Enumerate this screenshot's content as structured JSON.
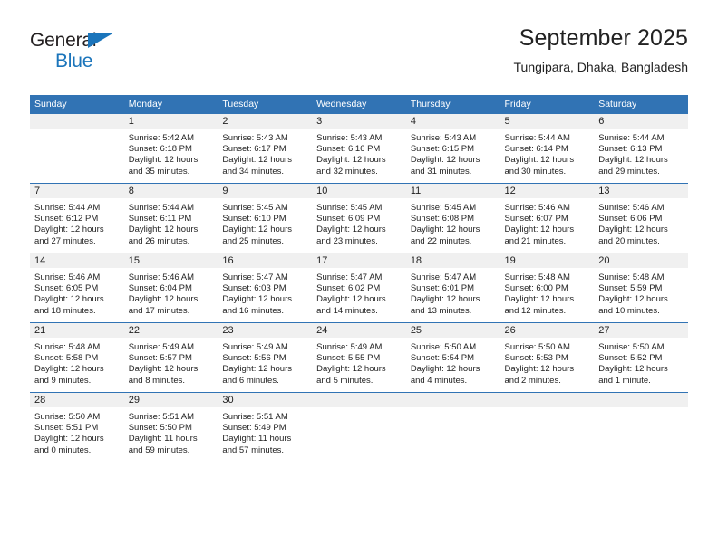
{
  "brand": {
    "line1": "General",
    "line2": "Blue",
    "triangle_color": "#1b75bb",
    "text_color": "#231f20"
  },
  "header": {
    "title": "September 2025",
    "subtitle": "Tungipara, Dhaka, Bangladesh"
  },
  "theme": {
    "accent": "#3173b4",
    "band": "#f0f0f0",
    "text": "#222222"
  },
  "calendar": {
    "weekday_headers": [
      "Sunday",
      "Monday",
      "Tuesday",
      "Wednesday",
      "Thursday",
      "Friday",
      "Saturday"
    ],
    "weeks": [
      [
        {
          "day": "",
          "sunrise": "",
          "sunset": "",
          "daylight_line1": "",
          "daylight_line2": ""
        },
        {
          "day": "1",
          "sunrise": "Sunrise: 5:42 AM",
          "sunset": "Sunset: 6:18 PM",
          "daylight_line1": "Daylight: 12 hours",
          "daylight_line2": "and 35 minutes."
        },
        {
          "day": "2",
          "sunrise": "Sunrise: 5:43 AM",
          "sunset": "Sunset: 6:17 PM",
          "daylight_line1": "Daylight: 12 hours",
          "daylight_line2": "and 34 minutes."
        },
        {
          "day": "3",
          "sunrise": "Sunrise: 5:43 AM",
          "sunset": "Sunset: 6:16 PM",
          "daylight_line1": "Daylight: 12 hours",
          "daylight_line2": "and 32 minutes."
        },
        {
          "day": "4",
          "sunrise": "Sunrise: 5:43 AM",
          "sunset": "Sunset: 6:15 PM",
          "daylight_line1": "Daylight: 12 hours",
          "daylight_line2": "and 31 minutes."
        },
        {
          "day": "5",
          "sunrise": "Sunrise: 5:44 AM",
          "sunset": "Sunset: 6:14 PM",
          "daylight_line1": "Daylight: 12 hours",
          "daylight_line2": "and 30 minutes."
        },
        {
          "day": "6",
          "sunrise": "Sunrise: 5:44 AM",
          "sunset": "Sunset: 6:13 PM",
          "daylight_line1": "Daylight: 12 hours",
          "daylight_line2": "and 29 minutes."
        }
      ],
      [
        {
          "day": "7",
          "sunrise": "Sunrise: 5:44 AM",
          "sunset": "Sunset: 6:12 PM",
          "daylight_line1": "Daylight: 12 hours",
          "daylight_line2": "and 27 minutes."
        },
        {
          "day": "8",
          "sunrise": "Sunrise: 5:44 AM",
          "sunset": "Sunset: 6:11 PM",
          "daylight_line1": "Daylight: 12 hours",
          "daylight_line2": "and 26 minutes."
        },
        {
          "day": "9",
          "sunrise": "Sunrise: 5:45 AM",
          "sunset": "Sunset: 6:10 PM",
          "daylight_line1": "Daylight: 12 hours",
          "daylight_line2": "and 25 minutes."
        },
        {
          "day": "10",
          "sunrise": "Sunrise: 5:45 AM",
          "sunset": "Sunset: 6:09 PM",
          "daylight_line1": "Daylight: 12 hours",
          "daylight_line2": "and 23 minutes."
        },
        {
          "day": "11",
          "sunrise": "Sunrise: 5:45 AM",
          "sunset": "Sunset: 6:08 PM",
          "daylight_line1": "Daylight: 12 hours",
          "daylight_line2": "and 22 minutes."
        },
        {
          "day": "12",
          "sunrise": "Sunrise: 5:46 AM",
          "sunset": "Sunset: 6:07 PM",
          "daylight_line1": "Daylight: 12 hours",
          "daylight_line2": "and 21 minutes."
        },
        {
          "day": "13",
          "sunrise": "Sunrise: 5:46 AM",
          "sunset": "Sunset: 6:06 PM",
          "daylight_line1": "Daylight: 12 hours",
          "daylight_line2": "and 20 minutes."
        }
      ],
      [
        {
          "day": "14",
          "sunrise": "Sunrise: 5:46 AM",
          "sunset": "Sunset: 6:05 PM",
          "daylight_line1": "Daylight: 12 hours",
          "daylight_line2": "and 18 minutes."
        },
        {
          "day": "15",
          "sunrise": "Sunrise: 5:46 AM",
          "sunset": "Sunset: 6:04 PM",
          "daylight_line1": "Daylight: 12 hours",
          "daylight_line2": "and 17 minutes."
        },
        {
          "day": "16",
          "sunrise": "Sunrise: 5:47 AM",
          "sunset": "Sunset: 6:03 PM",
          "daylight_line1": "Daylight: 12 hours",
          "daylight_line2": "and 16 minutes."
        },
        {
          "day": "17",
          "sunrise": "Sunrise: 5:47 AM",
          "sunset": "Sunset: 6:02 PM",
          "daylight_line1": "Daylight: 12 hours",
          "daylight_line2": "and 14 minutes."
        },
        {
          "day": "18",
          "sunrise": "Sunrise: 5:47 AM",
          "sunset": "Sunset: 6:01 PM",
          "daylight_line1": "Daylight: 12 hours",
          "daylight_line2": "and 13 minutes."
        },
        {
          "day": "19",
          "sunrise": "Sunrise: 5:48 AM",
          "sunset": "Sunset: 6:00 PM",
          "daylight_line1": "Daylight: 12 hours",
          "daylight_line2": "and 12 minutes."
        },
        {
          "day": "20",
          "sunrise": "Sunrise: 5:48 AM",
          "sunset": "Sunset: 5:59 PM",
          "daylight_line1": "Daylight: 12 hours",
          "daylight_line2": "and 10 minutes."
        }
      ],
      [
        {
          "day": "21",
          "sunrise": "Sunrise: 5:48 AM",
          "sunset": "Sunset: 5:58 PM",
          "daylight_line1": "Daylight: 12 hours",
          "daylight_line2": "and 9 minutes."
        },
        {
          "day": "22",
          "sunrise": "Sunrise: 5:49 AM",
          "sunset": "Sunset: 5:57 PM",
          "daylight_line1": "Daylight: 12 hours",
          "daylight_line2": "and 8 minutes."
        },
        {
          "day": "23",
          "sunrise": "Sunrise: 5:49 AM",
          "sunset": "Sunset: 5:56 PM",
          "daylight_line1": "Daylight: 12 hours",
          "daylight_line2": "and 6 minutes."
        },
        {
          "day": "24",
          "sunrise": "Sunrise: 5:49 AM",
          "sunset": "Sunset: 5:55 PM",
          "daylight_line1": "Daylight: 12 hours",
          "daylight_line2": "and 5 minutes."
        },
        {
          "day": "25",
          "sunrise": "Sunrise: 5:50 AM",
          "sunset": "Sunset: 5:54 PM",
          "daylight_line1": "Daylight: 12 hours",
          "daylight_line2": "and 4 minutes."
        },
        {
          "day": "26",
          "sunrise": "Sunrise: 5:50 AM",
          "sunset": "Sunset: 5:53 PM",
          "daylight_line1": "Daylight: 12 hours",
          "daylight_line2": "and 2 minutes."
        },
        {
          "day": "27",
          "sunrise": "Sunrise: 5:50 AM",
          "sunset": "Sunset: 5:52 PM",
          "daylight_line1": "Daylight: 12 hours",
          "daylight_line2": "and 1 minute."
        }
      ],
      [
        {
          "day": "28",
          "sunrise": "Sunrise: 5:50 AM",
          "sunset": "Sunset: 5:51 PM",
          "daylight_line1": "Daylight: 12 hours",
          "daylight_line2": "and 0 minutes."
        },
        {
          "day": "29",
          "sunrise": "Sunrise: 5:51 AM",
          "sunset": "Sunset: 5:50 PM",
          "daylight_line1": "Daylight: 11 hours",
          "daylight_line2": "and 59 minutes."
        },
        {
          "day": "30",
          "sunrise": "Sunrise: 5:51 AM",
          "sunset": "Sunset: 5:49 PM",
          "daylight_line1": "Daylight: 11 hours",
          "daylight_line2": "and 57 minutes."
        },
        {
          "day": "",
          "sunrise": "",
          "sunset": "",
          "daylight_line1": "",
          "daylight_line2": ""
        },
        {
          "day": "",
          "sunrise": "",
          "sunset": "",
          "daylight_line1": "",
          "daylight_line2": ""
        },
        {
          "day": "",
          "sunrise": "",
          "sunset": "",
          "daylight_line1": "",
          "daylight_line2": ""
        },
        {
          "day": "",
          "sunrise": "",
          "sunset": "",
          "daylight_line1": "",
          "daylight_line2": ""
        }
      ]
    ]
  }
}
